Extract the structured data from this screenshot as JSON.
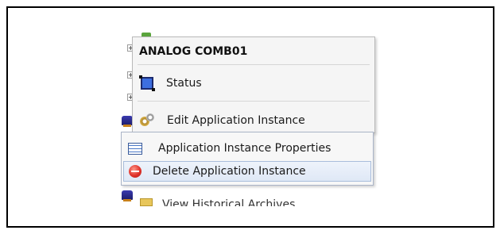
{
  "context_menu": {
    "header": "ANALOG COMB01",
    "items": [
      {
        "label": "Status",
        "icon": "status-icon"
      },
      {
        "label": "Edit Application Instance",
        "icon": "gear-icon"
      }
    ]
  },
  "submenu": {
    "items": [
      {
        "label": "Application Instance Properties",
        "icon": "properties-icon"
      },
      {
        "label": "Delete Application Instance",
        "icon": "delete-icon",
        "highlighted": true
      }
    ]
  },
  "background_tree": {
    "partial_item_label": "View Historical Archives"
  }
}
